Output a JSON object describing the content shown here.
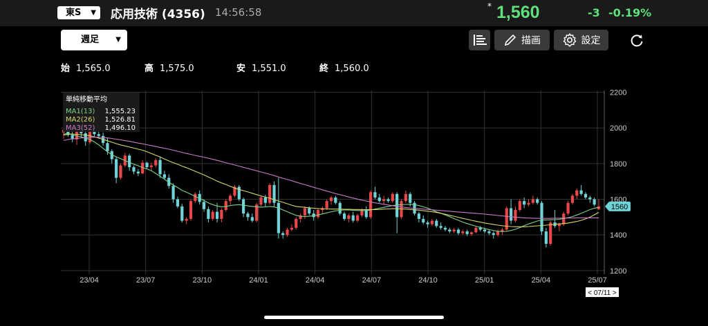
{
  "header": {
    "market": "東S",
    "title": "応用技術 (4356)",
    "time": "14:56:58",
    "star": "*",
    "price": "1,560",
    "change": "-3",
    "change_pct": "-0.19%"
  },
  "toolbar": {
    "period": "週足",
    "draw_label": "描画",
    "settings_label": "設定"
  },
  "ohlc": {
    "open_label": "始",
    "open": "1,565.0",
    "high_label": "高",
    "high": "1,575.0",
    "low_label": "安",
    "low": "1,551.0",
    "close_label": "終",
    "close": "1,560.0"
  },
  "legend": {
    "title": "単純移動平均",
    "items": [
      {
        "name": "MA1(13)",
        "value": "1,555.23"
      },
      {
        "name": "MA2(26)",
        "value": "1,526.81"
      },
      {
        "name": "MA3(52)",
        "value": "1,496.10"
      }
    ]
  },
  "colors": {
    "up": "#e8484a",
    "down": "#6fd3d8",
    "ma1": "#7ed48c",
    "ma2": "#d6d86a",
    "ma3": "#c97ac6",
    "price": "#5fe07a",
    "grid": "#333333"
  },
  "chart_data": {
    "type": "candlestick",
    "x_ticks": [
      "23/04",
      "23/07",
      "23/10",
      "24/01",
      "24/04",
      "24/07",
      "24/10",
      "25/01",
      "25/04",
      "25/07"
    ],
    "y_ticks": [
      1200,
      1400,
      1600,
      1800,
      2000,
      2200
    ],
    "ylim": [
      1180,
      2210
    ],
    "last_price_label": "1560",
    "date_label": "< 07/11 >",
    "candles": [
      [
        1975,
        2000,
        1940,
        1990
      ],
      [
        1990,
        2010,
        1950,
        1960
      ],
      [
        1960,
        1985,
        1920,
        1940
      ],
      [
        1935,
        1995,
        1905,
        1985
      ],
      [
        1985,
        2010,
        1950,
        1970
      ],
      [
        1970,
        1990,
        1900,
        1925
      ],
      [
        1920,
        2005,
        1910,
        1990
      ],
      [
        1985,
        2000,
        1950,
        1965
      ],
      [
        1965,
        1985,
        1940,
        1955
      ],
      [
        1955,
        1975,
        1900,
        1915
      ],
      [
        1915,
        1945,
        1850,
        1870
      ],
      [
        1870,
        1880,
        1800,
        1825
      ],
      [
        1825,
        1840,
        1690,
        1720
      ],
      [
        1720,
        1800,
        1710,
        1790
      ],
      [
        1790,
        1860,
        1780,
        1845
      ],
      [
        1845,
        1855,
        1760,
        1780
      ],
      [
        1780,
        1790,
        1740,
        1755
      ],
      [
        1755,
        1770,
        1730,
        1745
      ],
      [
        1745,
        1820,
        1740,
        1805
      ],
      [
        1805,
        1810,
        1770,
        1780
      ],
      [
        1780,
        1805,
        1760,
        1790
      ],
      [
        1790,
        1830,
        1780,
        1820
      ],
      [
        1820,
        1840,
        1720,
        1740
      ],
      [
        1740,
        1760,
        1710,
        1720
      ],
      [
        1720,
        1740,
        1660,
        1675
      ],
      [
        1675,
        1690,
        1580,
        1600
      ],
      [
        1600,
        1615,
        1550,
        1560
      ],
      [
        1560,
        1575,
        1470,
        1480
      ],
      [
        1480,
        1500,
        1460,
        1490
      ],
      [
        1490,
        1600,
        1480,
        1590
      ],
      [
        1590,
        1640,
        1580,
        1630
      ],
      [
        1630,
        1650,
        1570,
        1585
      ],
      [
        1585,
        1600,
        1530,
        1545
      ],
      [
        1545,
        1560,
        1470,
        1490
      ],
      [
        1490,
        1540,
        1480,
        1530
      ],
      [
        1530,
        1580,
        1470,
        1490
      ],
      [
        1490,
        1550,
        1470,
        1540
      ],
      [
        1540,
        1600,
        1530,
        1590
      ],
      [
        1590,
        1630,
        1570,
        1620
      ],
      [
        1620,
        1680,
        1610,
        1670
      ],
      [
        1670,
        1680,
        1590,
        1600
      ],
      [
        1600,
        1610,
        1500,
        1520
      ],
      [
        1520,
        1530,
        1480,
        1500
      ],
      [
        1500,
        1520,
        1470,
        1480
      ],
      [
        1480,
        1580,
        1470,
        1570
      ],
      [
        1570,
        1620,
        1560,
        1610
      ],
      [
        1610,
        1625,
        1560,
        1580
      ],
      [
        1580,
        1690,
        1570,
        1680
      ],
      [
        1680,
        1700,
        1560,
        1580
      ],
      [
        1580,
        1720,
        1380,
        1410
      ],
      [
        1410,
        1420,
        1380,
        1400
      ],
      [
        1400,
        1440,
        1390,
        1430
      ],
      [
        1430,
        1460,
        1420,
        1440
      ],
      [
        1440,
        1500,
        1430,
        1490
      ],
      [
        1490,
        1520,
        1470,
        1510
      ],
      [
        1510,
        1560,
        1490,
        1550
      ],
      [
        1550,
        1560,
        1510,
        1520
      ],
      [
        1520,
        1540,
        1480,
        1500
      ],
      [
        1500,
        1550,
        1490,
        1540
      ],
      [
        1540,
        1560,
        1520,
        1550
      ],
      [
        1550,
        1600,
        1540,
        1590
      ],
      [
        1590,
        1620,
        1570,
        1610
      ],
      [
        1610,
        1620,
        1570,
        1580
      ],
      [
        1580,
        1590,
        1510,
        1520
      ],
      [
        1520,
        1530,
        1480,
        1490
      ],
      [
        1490,
        1520,
        1470,
        1510
      ],
      [
        1510,
        1530,
        1470,
        1480
      ],
      [
        1480,
        1520,
        1470,
        1510
      ],
      [
        1510,
        1550,
        1500,
        1540
      ],
      [
        1540,
        1560,
        1490,
        1500
      ],
      [
        1500,
        1650,
        1490,
        1640
      ],
      [
        1640,
        1670,
        1600,
        1610
      ],
      [
        1610,
        1630,
        1580,
        1590
      ],
      [
        1590,
        1620,
        1570,
        1600
      ],
      [
        1600,
        1610,
        1580,
        1590
      ],
      [
        1590,
        1640,
        1580,
        1630
      ],
      [
        1630,
        1640,
        1410,
        1500
      ],
      [
        1500,
        1600,
        1490,
        1590
      ],
      [
        1590,
        1650,
        1580,
        1630
      ],
      [
        1630,
        1640,
        1560,
        1580
      ],
      [
        1580,
        1590,
        1510,
        1520
      ],
      [
        1520,
        1530,
        1470,
        1490
      ],
      [
        1490,
        1510,
        1460,
        1470
      ],
      [
        1470,
        1480,
        1440,
        1460
      ],
      [
        1460,
        1490,
        1450,
        1480
      ],
      [
        1480,
        1490,
        1440,
        1450
      ],
      [
        1450,
        1470,
        1430,
        1440
      ],
      [
        1440,
        1450,
        1420,
        1430
      ],
      [
        1430,
        1440,
        1410,
        1420
      ],
      [
        1420,
        1440,
        1410,
        1430
      ],
      [
        1430,
        1440,
        1400,
        1410
      ],
      [
        1410,
        1430,
        1400,
        1420
      ],
      [
        1420,
        1430,
        1395,
        1405
      ],
      [
        1405,
        1420,
        1395,
        1415
      ],
      [
        1415,
        1450,
        1410,
        1440
      ],
      [
        1440,
        1450,
        1420,
        1430
      ],
      [
        1430,
        1440,
        1410,
        1420
      ],
      [
        1420,
        1430,
        1400,
        1410
      ],
      [
        1410,
        1420,
        1380,
        1400
      ],
      [
        1400,
        1430,
        1390,
        1420
      ],
      [
        1420,
        1440,
        1400,
        1430
      ],
      [
        1430,
        1560,
        1420,
        1550
      ],
      [
        1550,
        1600,
        1460,
        1480
      ],
      [
        1480,
        1560,
        1470,
        1540
      ],
      [
        1540,
        1600,
        1530,
        1590
      ],
      [
        1590,
        1610,
        1550,
        1570
      ],
      [
        1570,
        1600,
        1560,
        1580
      ],
      [
        1580,
        1620,
        1570,
        1600
      ],
      [
        1600,
        1610,
        1570,
        1580
      ],
      [
        1580,
        1590,
        1400,
        1420
      ],
      [
        1420,
        1440,
        1330,
        1350
      ],
      [
        1350,
        1480,
        1340,
        1470
      ],
      [
        1470,
        1540,
        1440,
        1450
      ],
      [
        1450,
        1470,
        1420,
        1460
      ],
      [
        1460,
        1530,
        1450,
        1520
      ],
      [
        1520,
        1590,
        1510,
        1580
      ],
      [
        1580,
        1630,
        1570,
        1620
      ],
      [
        1620,
        1660,
        1600,
        1650
      ],
      [
        1650,
        1680,
        1620,
        1630
      ],
      [
        1630,
        1640,
        1600,
        1610
      ],
      [
        1610,
        1620,
        1580,
        1600
      ],
      [
        1600,
        1610,
        1560,
        1570
      ],
      [
        1545,
        1600,
        1540,
        1560
      ]
    ],
    "series": [
      {
        "name": "MA1(13)",
        "values": [
          1965,
          1970,
          1962,
          1955,
          1950,
          1943,
          1935,
          1922,
          1905,
          1886,
          1866,
          1850,
          1838,
          1828,
          1817,
          1807,
          1797,
          1788,
          1778,
          1770,
          1760,
          1745,
          1729,
          1712,
          1695,
          1680,
          1666,
          1650,
          1640,
          1628,
          1616,
          1604,
          1594,
          1580,
          1570,
          1562,
          1558,
          1560,
          1565,
          1568,
          1570,
          1567,
          1563,
          1560,
          1558,
          1556,
          1557,
          1560,
          1557,
          1550,
          1540,
          1530,
          1520,
          1510,
          1505,
          1503,
          1505,
          1508,
          1512,
          1518,
          1524,
          1530,
          1535,
          1538,
          1540,
          1540,
          1538,
          1537,
          1537,
          1536,
          1540,
          1545,
          1550,
          1555,
          1560,
          1565,
          1568,
          1570,
          1571,
          1572,
          1570,
          1565,
          1558,
          1550,
          1540,
          1530,
          1522,
          1512,
          1502,
          1492,
          1482,
          1472,
          1464,
          1456,
          1449,
          1442,
          1436,
          1430,
          1425,
          1421,
          1419,
          1420,
          1425,
          1432,
          1441,
          1452,
          1462,
          1470,
          1478,
          1484,
          1484,
          1485,
          1486,
          1488,
          1492,
          1497,
          1503,
          1512,
          1522,
          1532,
          1542,
          1550,
          1555
        ]
      },
      {
        "name": "MA2(26)",
        "values": [
          1960,
          1965,
          1966,
          1964,
          1962,
          1960,
          1956,
          1950,
          1943,
          1936,
          1928,
          1920,
          1912,
          1905,
          1899,
          1893,
          1887,
          1881,
          1875,
          1867,
          1857,
          1847,
          1837,
          1826,
          1815,
          1805,
          1796,
          1786,
          1777,
          1767,
          1757,
          1747,
          1737,
          1725,
          1714,
          1702,
          1692,
          1683,
          1673,
          1663,
          1655,
          1648,
          1641,
          1634,
          1626,
          1619,
          1612,
          1606,
          1598,
          1590,
          1583,
          1575,
          1567,
          1560,
          1557,
          1555,
          1552,
          1550,
          1548,
          1547,
          1546,
          1545,
          1545,
          1545,
          1544,
          1544,
          1543,
          1543,
          1542,
          1542,
          1542,
          1542,
          1543,
          1545,
          1546,
          1547,
          1547,
          1546,
          1545,
          1543,
          1541,
          1539,
          1536,
          1533,
          1530,
          1526,
          1521,
          1516,
          1510,
          1505,
          1499,
          1493,
          1488,
          1482,
          1477,
          1472,
          1467,
          1463,
          1459,
          1455,
          1452,
          1449,
          1447,
          1446,
          1446,
          1446,
          1447,
          1449,
          1451,
          1453,
          1455,
          1457,
          1460,
          1462,
          1464,
          1467,
          1471,
          1476,
          1482,
          1490,
          1500,
          1513,
          1527
        ]
      },
      {
        "name": "MA3(52)",
        "values": [
          1930,
          1935,
          1938,
          1941,
          1944,
          1946,
          1947,
          1948,
          1948,
          1946,
          1944,
          1941,
          1937,
          1933,
          1929,
          1925,
          1920,
          1915,
          1911,
          1906,
          1901,
          1896,
          1891,
          1886,
          1881,
          1875,
          1869,
          1863,
          1857,
          1852,
          1846,
          1841,
          1836,
          1830,
          1824,
          1818,
          1812,
          1805,
          1799,
          1792,
          1786,
          1779,
          1773,
          1766,
          1760,
          1753,
          1747,
          1740,
          1733,
          1725,
          1718,
          1711,
          1704,
          1696,
          1689,
          1682,
          1675,
          1667,
          1660,
          1653,
          1646,
          1639,
          1632,
          1626,
          1620,
          1613,
          1607,
          1601,
          1595,
          1590,
          1585,
          1580,
          1576,
          1572,
          1568,
          1564,
          1560,
          1557,
          1554,
          1551,
          1549,
          1547,
          1545,
          1543,
          1541,
          1539,
          1537,
          1535,
          1533,
          1531,
          1529,
          1527,
          1525,
          1523,
          1521,
          1519,
          1517,
          1514,
          1512,
          1509,
          1507,
          1504,
          1502,
          1500,
          1498,
          1496,
          1495,
          1494,
          1493,
          1493,
          1493,
          1493,
          1494,
          1494,
          1495,
          1495,
          1495,
          1496,
          1496,
          1496,
          1496,
          1496,
          1496
        ]
      }
    ]
  }
}
